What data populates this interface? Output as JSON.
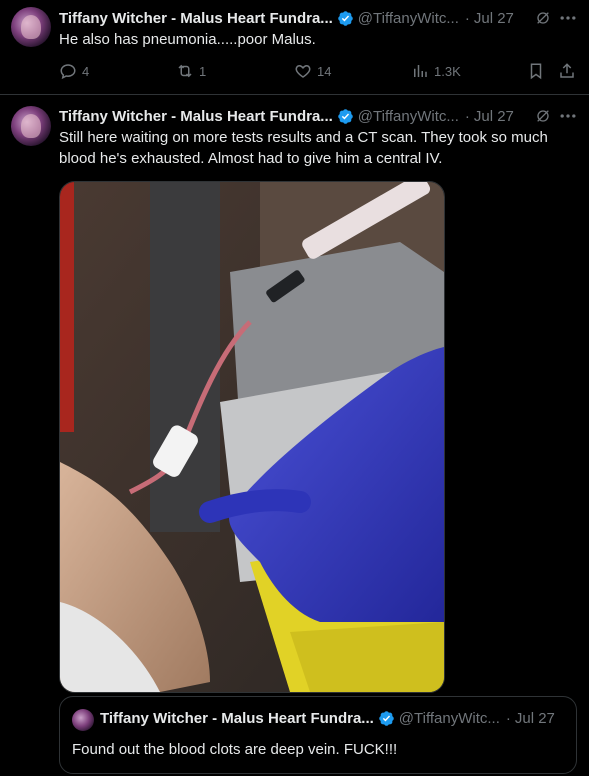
{
  "tweets": [
    {
      "name": "Tiffany Witcher - Malus Heart Fundra...",
      "handle": "@TiffanyWitc...",
      "date": "Jul 27",
      "text": "He also has pneumonia.....poor Malus.",
      "replies": "4",
      "reposts": "1",
      "likes": "14",
      "views": "1.3K"
    },
    {
      "name": "Tiffany Witcher - Malus Heart Fundra...",
      "handle": "@TiffanyWitc...",
      "date": "Jul 27",
      "text": "Still here waiting on more tests results and a CT scan. They took so much blood he's exhausted. Almost had to give him a central IV.",
      "quote": {
        "name": "Tiffany Witcher - Malus Heart Fundra...",
        "handle": "@TiffanyWitc...",
        "date": "Jul 27",
        "text": "Found out the blood clots are deep vein. FUCK!!!"
      }
    }
  ],
  "colors": {
    "verified": "#1d9bf0",
    "muted": "#71767b",
    "text": "#e7e9ea",
    "divider": "#2f3336"
  },
  "icons": [
    "reply-icon",
    "repost-icon",
    "like-icon",
    "views-icon",
    "bookmark-icon",
    "share-icon",
    "grok-icon",
    "more-icon",
    "verified-icon"
  ]
}
